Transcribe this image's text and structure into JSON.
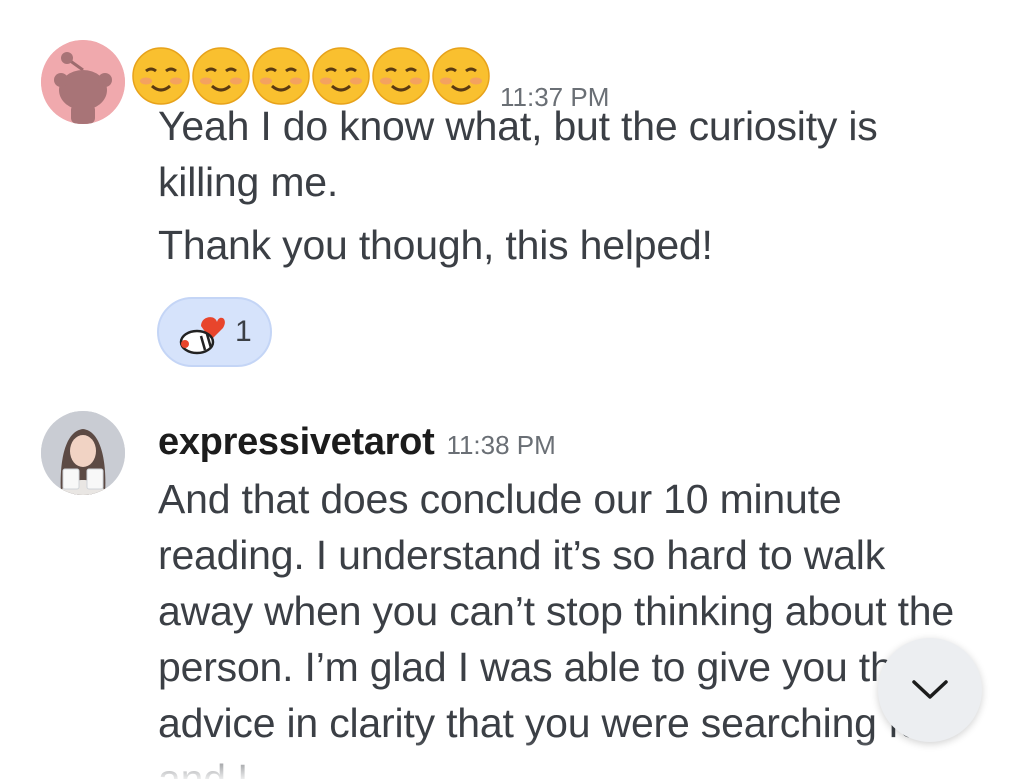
{
  "messages": [
    {
      "username_obscured": "u/██████",
      "username_cover": "emoji-smiling-face-row",
      "timestamp": "11:37 PM",
      "lines": [
        "Yeah I do know what, but the curiosity is killing me.",
        "Thank you though, this helped!"
      ],
      "avatar": "reddit-snoo-avatar",
      "reaction": {
        "icon": "snoo-heart-reaction-icon",
        "count": "1"
      }
    },
    {
      "username": "expressivetarot",
      "timestamp": "11:38 PM",
      "avatar": "user-photo-avatar",
      "text": "And that does conclude our 10 minute reading. I understand it’s so hard to walk away when you can’t stop thinking about the person. I’m glad I was able to give you the advice in clarity that you were searching for and I"
    }
  ],
  "scroll_button": {
    "icon": "chevron-down-icon"
  },
  "colors": {
    "reaction_bg": "#d6e3fb",
    "avatar_pink": "#f0a9ad",
    "body_text": "#3b3f45",
    "timestamp": "#6a6f75"
  }
}
